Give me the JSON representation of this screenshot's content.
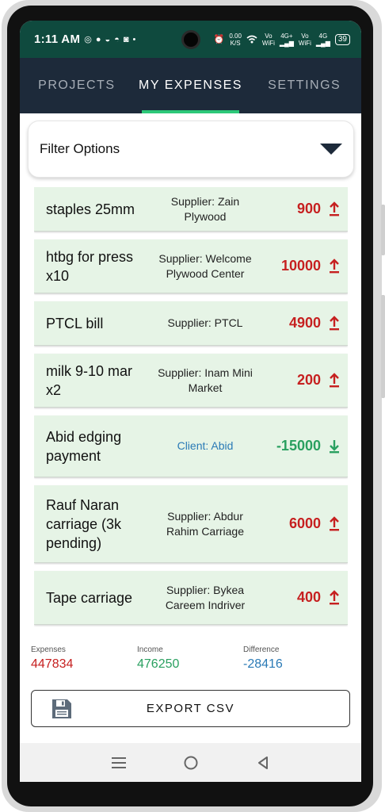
{
  "status_bar": {
    "time": "1:11 AM",
    "speed_value": "0.00",
    "speed_unit": "K/S",
    "net1_top": "Vo",
    "net1_bottom": "WiFi",
    "net1_gen": "4G+",
    "net2_top": "Vo",
    "net2_bottom": "WiFi",
    "net2_gen": "4G",
    "battery": "39"
  },
  "tabs": [
    {
      "label": "PROJECTS",
      "active": false
    },
    {
      "label": "MY EXPENSES",
      "active": true
    },
    {
      "label": "SETTINGS",
      "active": false
    }
  ],
  "filter": {
    "label": "Filter Options"
  },
  "transactions": [
    {
      "title": "staples 25mm",
      "party": "Supplier: Zain Plywood",
      "amount": "900",
      "kind": "expense"
    },
    {
      "title": "htbg for press x10",
      "party": "Supplier: Welcome Plywood Center",
      "amount": "10000",
      "kind": "expense"
    },
    {
      "title": "PTCL bill",
      "party": "Supplier: PTCL",
      "amount": "4900",
      "kind": "expense"
    },
    {
      "title": "milk 9-10 mar x2",
      "party": "Supplier: Inam Mini Market",
      "amount": "200",
      "kind": "expense"
    },
    {
      "title": "Abid edging payment",
      "party": "Client: Abid",
      "amount": "-15000",
      "kind": "income"
    },
    {
      "title": "Rauf Naran carriage (3k pending)",
      "party": "Supplier: Abdur Rahim Carriage",
      "amount": "6000",
      "kind": "expense"
    },
    {
      "title": "Tape carriage",
      "party": "Supplier: Bykea Careem Indriver",
      "amount": "400",
      "kind": "expense"
    }
  ],
  "summary": {
    "expenses_label": "Expenses",
    "expenses_value": "447834",
    "income_label": "Income",
    "income_value": "476250",
    "difference_label": "Difference",
    "difference_value": "-28416"
  },
  "export": {
    "label": "EXPORT CSV"
  },
  "colors": {
    "header": "#1d2a3a",
    "status_bar": "#0f4a3e",
    "tab_indicator": "#2dc879",
    "expense": "#c62020",
    "income": "#2aa060",
    "difference": "#2a7ab6",
    "row_bg": "#e6f4e6"
  }
}
